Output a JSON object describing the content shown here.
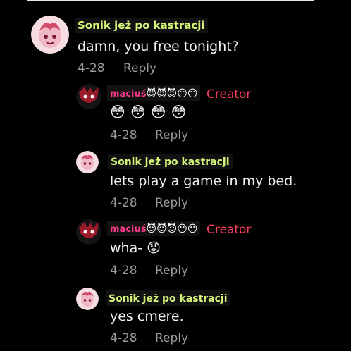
{
  "comments": [
    {
      "author": "Sonik jeż po kastracji",
      "text": "damn, you free tonight?",
      "date": "4-28",
      "reply": "Reply"
    },
    {
      "author": "maciuś",
      "author_emojis": "😈😈😈😶😶",
      "badge": "Creator",
      "text": "😳😳😳😳",
      "date": "4-28",
      "reply": "Reply"
    },
    {
      "author": "Sonik jeż po kastracji",
      "text": "lets play a game in my bed.",
      "date": "4-28",
      "reply": "Reply"
    },
    {
      "author": "maciuś",
      "author_emojis": "😈😈😈😶😶",
      "badge": "Creator",
      "text": "wha- 😟",
      "date": "4-28",
      "reply": "Reply"
    },
    {
      "author": "Sonik jeż po kastracji",
      "text": "yes cmere.",
      "date": "4-28",
      "reply": "Reply"
    }
  ]
}
